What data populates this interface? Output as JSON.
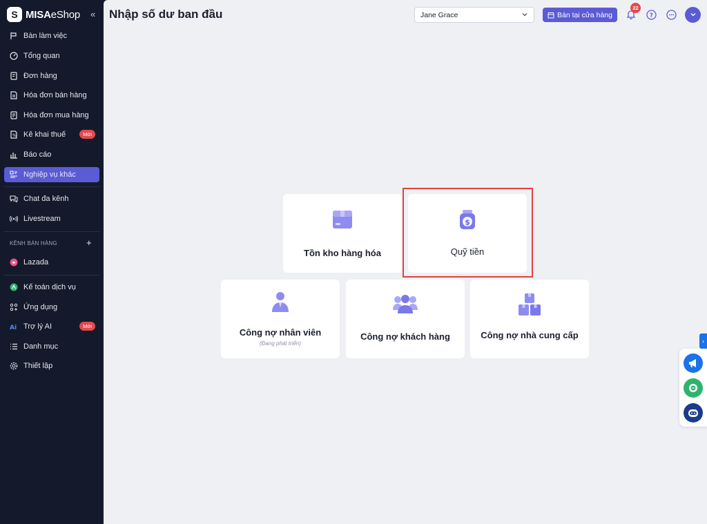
{
  "brand": {
    "name_bold": "MISA",
    "name_light": "eShop"
  },
  "sidebar": {
    "items": [
      {
        "label": "Bàn làm việc",
        "icon": "desk-icon"
      },
      {
        "label": "Tổng quan",
        "icon": "dashboard-icon"
      },
      {
        "label": "Đơn hàng",
        "icon": "order-icon"
      },
      {
        "label": "Hóa đơn bán hàng",
        "icon": "sales-invoice-icon"
      },
      {
        "label": "Hóa đơn mua hàng",
        "icon": "purchase-invoice-icon"
      },
      {
        "label": "Kê khai thuế",
        "icon": "tax-icon",
        "badge": "Mới"
      },
      {
        "label": "Báo cáo",
        "icon": "report-icon"
      },
      {
        "label": "Nghiệp vụ khác",
        "icon": "other-ops-icon",
        "active": true
      },
      {
        "label": "Chat đa kênh",
        "icon": "chat-icon"
      },
      {
        "label": "Livestream",
        "icon": "livestream-icon"
      },
      {
        "label": "Lazada",
        "icon": "lazada-icon"
      },
      {
        "label": "Kế toán dịch vụ",
        "icon": "accounting-icon"
      },
      {
        "label": "Ứng dụng",
        "icon": "apps-icon"
      },
      {
        "label": "Trợ lý AI",
        "icon": "ai-icon",
        "badge": "Mới"
      },
      {
        "label": "Danh mục",
        "icon": "list-icon"
      },
      {
        "label": "Thiết lập",
        "icon": "settings-icon"
      }
    ],
    "section_label": "KÊNH BÁN HÀNG",
    "section_add": "+"
  },
  "header": {
    "title": "Nhập số dư ban đầu",
    "store_select": "Jane Grace",
    "sell_button": "Bán tại cửa hàng",
    "notification_count": "22"
  },
  "cards": [
    {
      "title": "Tồn kho hàng hóa",
      "icon": "inventory-box-icon"
    },
    {
      "title": "Quỹ tiền",
      "icon": "money-bag-icon"
    },
    {
      "title": "Công nợ nhân viên",
      "subtitle": "(Đang phát triển)",
      "icon": "employee-icon"
    },
    {
      "title": "Công nợ khách hàng",
      "icon": "customers-icon"
    },
    {
      "title": "Công nợ nhà cung cấp",
      "icon": "supplier-boxes-icon"
    }
  ],
  "colors": {
    "accent": "#5b5bd6",
    "sidebar_bg": "#141a2b",
    "badge": "#e5484d",
    "highlight": "#e0413d"
  }
}
